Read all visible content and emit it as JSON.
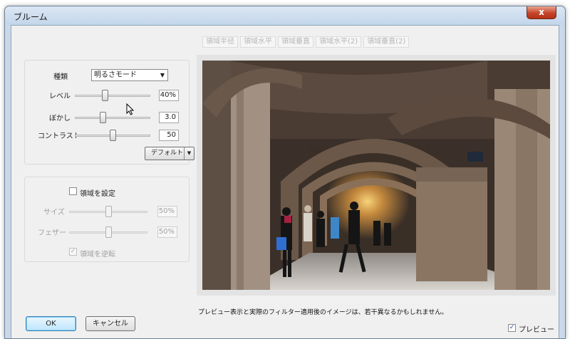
{
  "window": {
    "title": "ブルーム",
    "close_glyph": "x"
  },
  "tabs": [
    "領域半径",
    "領域水平",
    "領域垂直",
    "領域水平(2)",
    "領域垂直(2)"
  ],
  "bloom_group": {
    "type_label": "種類",
    "type_value": "明るさモード",
    "sliders": [
      {
        "label": "レベル",
        "value": "40%",
        "level": 0.4
      },
      {
        "label": "ぼかし",
        "value": "3.0",
        "level": 0.37
      },
      {
        "label": "コントラスト",
        "value": "50",
        "level": 0.5
      }
    ],
    "default_button": "デフォルト"
  },
  "region_group": {
    "set_region_label": "領域を設定",
    "set_region_checked": false,
    "sliders": [
      {
        "label": "サイズ",
        "value": "50%",
        "level": 0.5
      },
      {
        "label": "フェザー",
        "value": "50%",
        "level": 0.5
      }
    ],
    "invert_label": "領域を逆転",
    "invert_checked": true
  },
  "notice": "プレビュー表示と実際のフィルター適用後のイメージは、若干異なるかもしれません。",
  "buttons": {
    "ok": "OK",
    "cancel": "キャンセル"
  },
  "preview_check": {
    "label": "プレビュー",
    "checked": true
  }
}
